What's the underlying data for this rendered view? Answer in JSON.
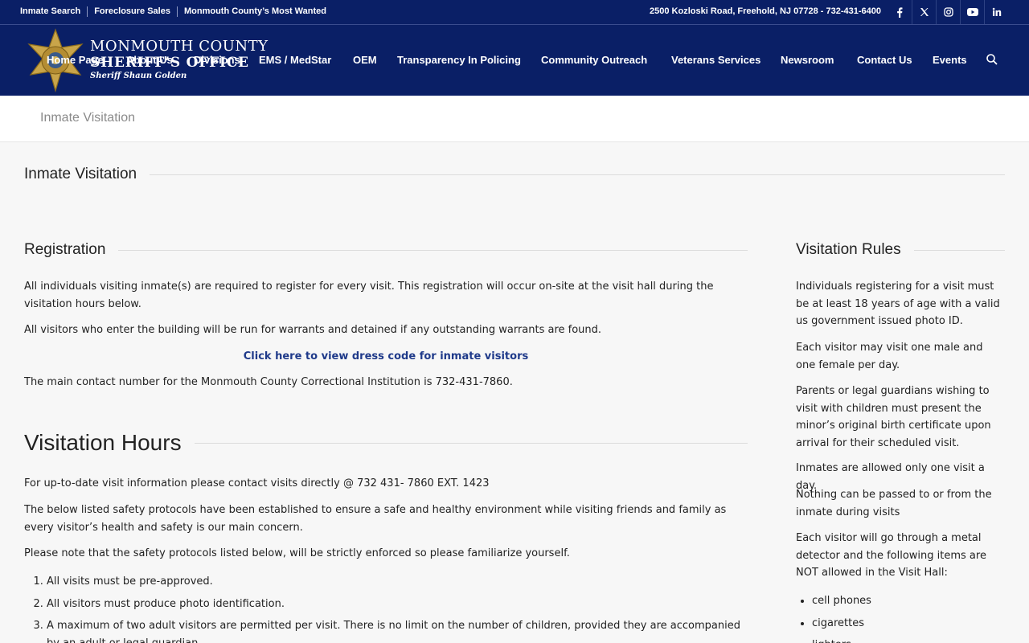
{
  "topbar": {
    "links": [
      "Inmate Search",
      "Foreclosure Sales",
      "Monmouth County’s Most Wanted"
    ],
    "address": "2500 Kozloski Road, Freehold, NJ 07728 - 732-431-6400",
    "social_icons": [
      "facebook-icon",
      "x-twitter-icon",
      "instagram-icon",
      "youtube-icon",
      "linkedin-icon"
    ]
  },
  "logo": {
    "line1": "MONMOUTH COUNTY",
    "line2": "SHERIFF’S OFFICE",
    "line3": "Sheriff Shaun Golden"
  },
  "nav": {
    "items": [
      "Home Page",
      "About Us",
      "Divisions",
      "EMS / MedStar",
      "OEM",
      "Transparency In Policing",
      "Community Outreach",
      "Veterans Services",
      "Newsroom",
      "Contact Us",
      "Events"
    ]
  },
  "page": {
    "breadcrumb_title": "Inmate Visitation",
    "section_title": "Inmate Visitation"
  },
  "registration": {
    "heading": "Registration",
    "p1": "All individuals visiting inmate(s) are required to register for every visit. This registration will occur on-site at the visit hall during the visitation hours below.",
    "p2": "All visitors who enter the building will be run for warrants and detained if any outstanding warrants are found.",
    "dress_code_link": "Click here to view dress code for inmate visitors",
    "p3": "The main contact number for the Monmouth County Correctional Institution is 732-431-7860."
  },
  "hours": {
    "heading": "Visitation Hours",
    "p1": "For up-to-date visit information please contact visits directly @ 732 431- 7860 EXT. 1423",
    "p2": "The below listed safety protocols have been established to ensure a safe and healthy environment while visiting friends and family as every visitor’s health and safety is our main concern.",
    "p3": "Please note that the safety protocols listed below, will be strictly enforced so please familiarize yourself.",
    "protocols": [
      "All visits must be pre-approved.",
      "All visitors must produce photo identification.",
      "A maximum of two adult visitors are permitted per visit. There is no limit on the number of children, provided they are accompanied by an adult or legal guardian."
    ]
  },
  "rules": {
    "heading": "Visitation Rules",
    "p1": "Individuals registering for a visit must be at least 18 years of age with a valid us government issued photo ID.",
    "p2": "Each visitor may visit one male and one female per day.",
    "p3": "Parents or legal guardians wishing to visit with children must present the minor’s original birth certificate upon arrival for their scheduled visit.",
    "p4": "Inmates are allowed only one visit a day.",
    "p5": "Nothing can be passed to or from the inmate during visits",
    "p6": "Each visitor will go through a metal detector and the following items are NOT allowed in the Visit Hall:",
    "prohibited": [
      "cell phones",
      "cigarettes",
      "lighters"
    ]
  },
  "colors": {
    "header_bg": "#0a1f66",
    "link": "#1f3a8a",
    "page_bg": "#f7f7f7"
  }
}
